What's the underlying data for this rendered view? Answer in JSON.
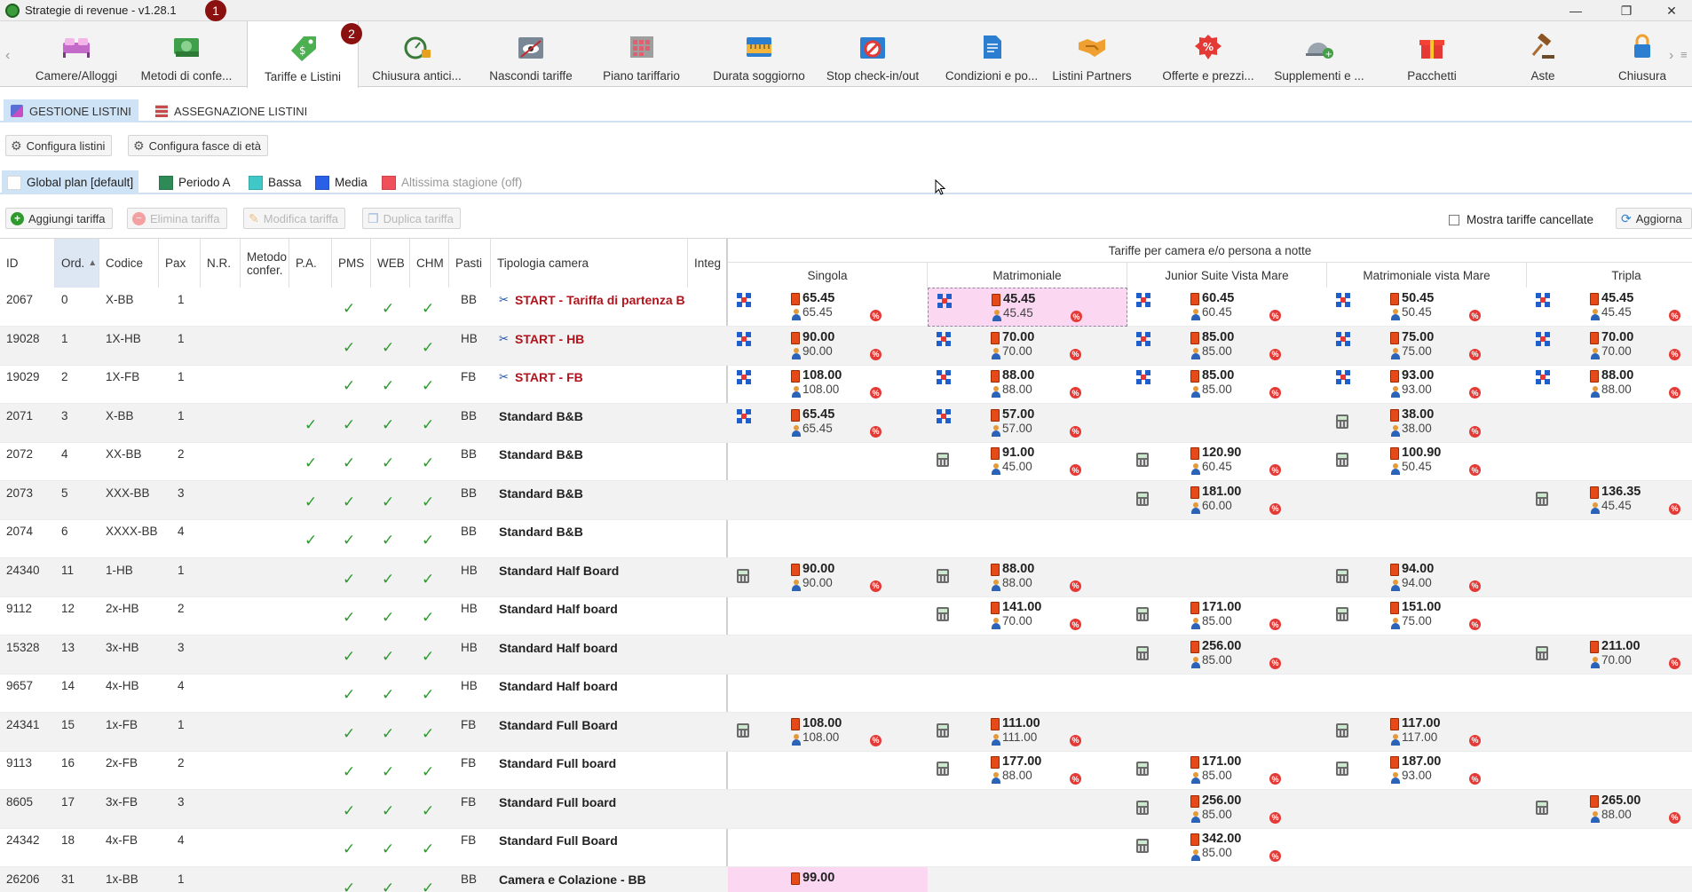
{
  "window": {
    "title": "Strategie di revenue - v1.28.1",
    "badge1": "1",
    "badge2": "2",
    "min": "—",
    "max": "❐",
    "close": "✕"
  },
  "toolbar": [
    {
      "label": "Camere/Alloggi",
      "icon": "bed-icon"
    },
    {
      "label": "Metodi di confe...",
      "icon": "money-icon"
    },
    {
      "label": "Tariffe e Listini",
      "icon": "price-tag-icon"
    },
    {
      "label": "Chiusura antici...",
      "icon": "stopwatch-lock-icon"
    },
    {
      "label": "Nascondi tariffe",
      "icon": "calendar-hidden-icon"
    },
    {
      "label": "Piano tariffario",
      "icon": "grid-calendar-icon"
    },
    {
      "label": "Durata soggiorno",
      "icon": "ruler-calendar-icon"
    },
    {
      "label": "Stop check-in/out",
      "icon": "calendar-stop-icon"
    },
    {
      "label": "Condizioni e po...",
      "icon": "document-icon"
    },
    {
      "label": "Listini Partners",
      "icon": "handshake-icon"
    },
    {
      "label": "Offerte e prezzi...",
      "icon": "discount-icon"
    },
    {
      "label": "Supplementi e ...",
      "icon": "service-bell-icon"
    },
    {
      "label": "Pacchetti",
      "icon": "gift-icon"
    },
    {
      "label": "Aste",
      "icon": "gavel-icon"
    },
    {
      "label": "Chiusura",
      "icon": "lock-icon"
    }
  ],
  "subtabs": {
    "gestione": "GESTIONE LISTINI",
    "assegnazione": "ASSEGNAZIONE LISTINI"
  },
  "config": {
    "listini": "Configura listini",
    "fasce": "Configura fasce di età"
  },
  "seasons": [
    {
      "label": "Global plan [default]",
      "color": "#ffffff"
    },
    {
      "label": "Periodo A",
      "color": "#2e8b57"
    },
    {
      "label": "Bassa",
      "color": "#40c8c8"
    },
    {
      "label": "Media",
      "color": "#2a5fe8"
    },
    {
      "label": "Altissima stagione (off)",
      "color": "#f0505a"
    }
  ],
  "actions": {
    "aggiungi": "Aggiungi tariffa",
    "elimina": "Elimina tariffa",
    "modifica": "Modifica tariffa",
    "duplica": "Duplica tariffa",
    "mostra": "Mostra tariffe cancellate",
    "aggiorna": "Aggiorna"
  },
  "headers": {
    "id": "ID",
    "ord": "Ord.",
    "codice": "Codice",
    "pax": "Pax",
    "nr": "N.R.",
    "metodo": "Metodo confer.",
    "pa": "P.A.",
    "pms": "PMS",
    "web": "WEB",
    "chm": "CHM",
    "pasti": "Pasti",
    "tipologia": "Tipologia camera",
    "integ": "Integ",
    "group": "Tariffe per camera e/o persona a notte"
  },
  "rooms": [
    "Singola",
    "Matrimoniale",
    "Junior Suite Vista Mare",
    "Matrimoniale vista Mare",
    "Tripla"
  ],
  "rows": [
    {
      "id": "2067",
      "ord": "0",
      "codice": "X-BB",
      "pax": "1",
      "pa": false,
      "pasti": "BB",
      "tip": "START - Tariffa di partenza B",
      "red": true,
      "prices": [
        {
          "t": "b",
          "a": "65.45",
          "b": "65.45"
        },
        {
          "t": "b",
          "a": "45.45",
          "b": "45.45",
          "hl": true
        },
        {
          "t": "b",
          "a": "60.45",
          "b": "60.45"
        },
        {
          "t": "b",
          "a": "50.45",
          "b": "50.45"
        },
        {
          "t": "b",
          "a": "45.45",
          "b": "45.45"
        }
      ]
    },
    {
      "id": "19028",
      "ord": "1",
      "codice": "1X-HB",
      "pax": "1",
      "pa": false,
      "pasti": "HB",
      "tip": "START - HB",
      "red": true,
      "prices": [
        {
          "t": "b",
          "a": "90.00",
          "b": "90.00"
        },
        {
          "t": "b",
          "a": "70.00",
          "b": "70.00"
        },
        {
          "t": "b",
          "a": "85.00",
          "b": "85.00"
        },
        {
          "t": "b",
          "a": "75.00",
          "b": "75.00"
        },
        {
          "t": "b",
          "a": "70.00",
          "b": "70.00"
        }
      ]
    },
    {
      "id": "19029",
      "ord": "2",
      "codice": "1X-FB",
      "pax": "1",
      "pa": false,
      "pasti": "FB",
      "tip": "START - FB",
      "red": true,
      "prices": [
        {
          "t": "b",
          "a": "108.00",
          "b": "108.00"
        },
        {
          "t": "b",
          "a": "88.00",
          "b": "88.00"
        },
        {
          "t": "b",
          "a": "85.00",
          "b": "85.00"
        },
        {
          "t": "b",
          "a": "93.00",
          "b": "93.00"
        },
        {
          "t": "b",
          "a": "88.00",
          "b": "88.00"
        }
      ]
    },
    {
      "id": "2071",
      "ord": "3",
      "codice": "X-BB",
      "pax": "1",
      "pa": true,
      "pasti": "BB",
      "tip": "Standard B&B",
      "red": false,
      "prices": [
        {
          "t": "b",
          "a": "65.45",
          "b": "65.45"
        },
        {
          "t": "b",
          "a": "57.00",
          "b": "57.00"
        },
        null,
        {
          "t": "c",
          "a": "38.00",
          "b": "38.00"
        },
        null
      ]
    },
    {
      "id": "2072",
      "ord": "4",
      "codice": "XX-BB",
      "pax": "2",
      "pa": true,
      "pasti": "BB",
      "tip": "Standard B&B",
      "red": false,
      "prices": [
        null,
        {
          "t": "c",
          "a": "91.00",
          "b": "45.00"
        },
        {
          "t": "c",
          "a": "120.90",
          "b": "60.45"
        },
        {
          "t": "c",
          "a": "100.90",
          "b": "50.45"
        },
        null
      ]
    },
    {
      "id": "2073",
      "ord": "5",
      "codice": "XXX-BB",
      "pax": "3",
      "pa": true,
      "pasti": "BB",
      "tip": "Standard B&B",
      "red": false,
      "prices": [
        null,
        null,
        {
          "t": "c",
          "a": "181.00",
          "b": "60.00"
        },
        null,
        {
          "t": "c",
          "a": "136.35",
          "b": "45.45"
        }
      ]
    },
    {
      "id": "2074",
      "ord": "6",
      "codice": "XXXX-BB",
      "pax": "4",
      "pa": true,
      "pasti": "BB",
      "tip": "Standard B&B",
      "red": false,
      "prices": [
        null,
        null,
        null,
        null,
        null
      ]
    },
    {
      "id": "24340",
      "ord": "11",
      "codice": "1-HB",
      "pax": "1",
      "pa": false,
      "pasti": "HB",
      "tip": "Standard Half Board",
      "red": false,
      "prices": [
        {
          "t": "c",
          "a": "90.00",
          "b": "90.00"
        },
        {
          "t": "c",
          "a": "88.00",
          "b": "88.00"
        },
        null,
        {
          "t": "c",
          "a": "94.00",
          "b": "94.00"
        },
        null
      ]
    },
    {
      "id": "9112",
      "ord": "12",
      "codice": "2x-HB",
      "pax": "2",
      "pa": false,
      "pasti": "HB",
      "tip": "Standard Half board",
      "red": false,
      "prices": [
        null,
        {
          "t": "c",
          "a": "141.00",
          "b": "70.00"
        },
        {
          "t": "c",
          "a": "171.00",
          "b": "85.00"
        },
        {
          "t": "c",
          "a": "151.00",
          "b": "75.00"
        },
        null
      ]
    },
    {
      "id": "15328",
      "ord": "13",
      "codice": "3x-HB",
      "pax": "3",
      "pa": false,
      "pasti": "HB",
      "tip": "Standard Half board",
      "red": false,
      "prices": [
        null,
        null,
        {
          "t": "c",
          "a": "256.00",
          "b": "85.00"
        },
        null,
        {
          "t": "c",
          "a": "211.00",
          "b": "70.00"
        }
      ]
    },
    {
      "id": "9657",
      "ord": "14",
      "codice": "4x-HB",
      "pax": "4",
      "pa": false,
      "pasti": "HB",
      "tip": "Standard Half board",
      "red": false,
      "prices": [
        null,
        null,
        null,
        null,
        null
      ]
    },
    {
      "id": "24341",
      "ord": "15",
      "codice": "1x-FB",
      "pax": "1",
      "pa": false,
      "pasti": "FB",
      "tip": "Standard Full Board",
      "red": false,
      "prices": [
        {
          "t": "c",
          "a": "108.00",
          "b": "108.00"
        },
        {
          "t": "c",
          "a": "111.00",
          "b": "111.00"
        },
        null,
        {
          "t": "c",
          "a": "117.00",
          "b": "117.00"
        },
        null
      ]
    },
    {
      "id": "9113",
      "ord": "16",
      "codice": "2x-FB",
      "pax": "2",
      "pa": false,
      "pasti": "FB",
      "tip": "Standard Full board",
      "red": false,
      "prices": [
        null,
        {
          "t": "c",
          "a": "177.00",
          "b": "88.00"
        },
        {
          "t": "c",
          "a": "171.00",
          "b": "85.00"
        },
        {
          "t": "c",
          "a": "187.00",
          "b": "93.00"
        },
        null
      ]
    },
    {
      "id": "8605",
      "ord": "17",
      "codice": "3x-FB",
      "pax": "3",
      "pa": false,
      "pasti": "FB",
      "tip": "Standard Full board",
      "red": false,
      "prices": [
        null,
        null,
        {
          "t": "c",
          "a": "256.00",
          "b": "85.00"
        },
        null,
        {
          "t": "c",
          "a": "265.00",
          "b": "88.00"
        }
      ]
    },
    {
      "id": "24342",
      "ord": "18",
      "codice": "4x-FB",
      "pax": "4",
      "pa": false,
      "pasti": "FB",
      "tip": "Standard Full Board",
      "red": false,
      "prices": [
        null,
        null,
        {
          "t": "c",
          "a": "342.00",
          "b": "85.00"
        },
        null,
        null
      ]
    },
    {
      "id": "26206",
      "ord": "31",
      "codice": "1x-BB",
      "pax": "1",
      "pa": false,
      "pasti": "BB",
      "tip": "Camera e Colazione - BB",
      "red": false,
      "prices": [
        {
          "t": "p",
          "a": "99.00",
          "b": ""
        },
        null,
        null,
        null,
        null
      ]
    }
  ]
}
